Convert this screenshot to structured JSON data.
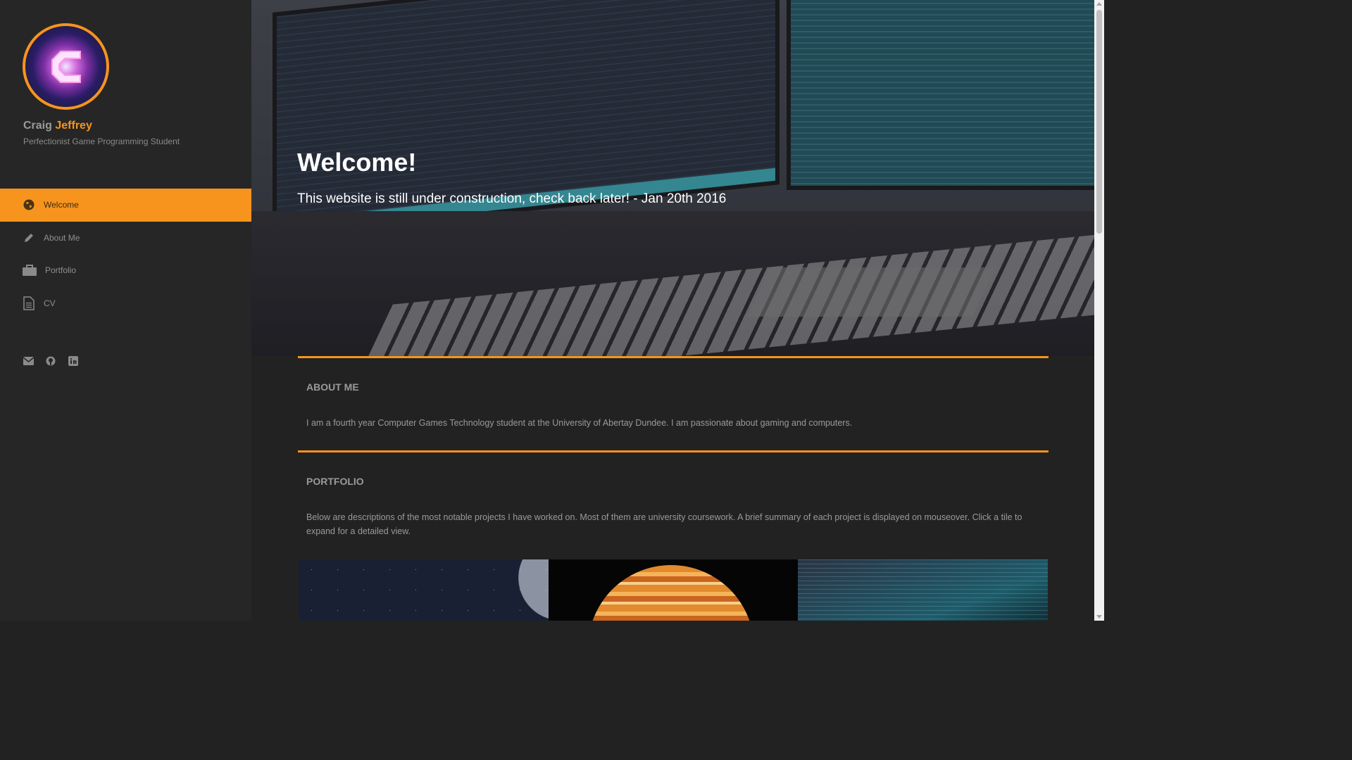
{
  "profile": {
    "first_name": "Craig",
    "last_name": "Jeffrey",
    "tagline": "Perfectionist Game Programming Student"
  },
  "nav": {
    "items": [
      {
        "label": "Welcome",
        "icon": "globe-icon",
        "active": true
      },
      {
        "label": "About Me",
        "icon": "pencil-icon",
        "active": false
      },
      {
        "label": "Portfolio",
        "icon": "briefcase-icon",
        "active": false
      },
      {
        "label": "CV",
        "icon": "document-icon",
        "active": false
      }
    ]
  },
  "social": [
    "envelope-icon",
    "github-icon",
    "linkedin-icon"
  ],
  "hero": {
    "title": "Welcome!",
    "subtitle": "This website is still under construction, check back later! - Jan 20th 2016"
  },
  "about": {
    "heading": "ABOUT ME",
    "text": "I am a fourth year Computer Games Technology student at the University of Abertay Dundee. I am passionate about gaming and computers."
  },
  "portfolio": {
    "heading": "PORTFOLIO",
    "text": "Below are descriptions of the most notable projects I have worked on. Most of them are university coursework. A brief summary of each project is displayed on mouseover. Click a tile to expand for a detailed view."
  },
  "colors": {
    "accent": "#f7941d",
    "sidebar_bg": "#262626",
    "page_bg": "#222222"
  }
}
